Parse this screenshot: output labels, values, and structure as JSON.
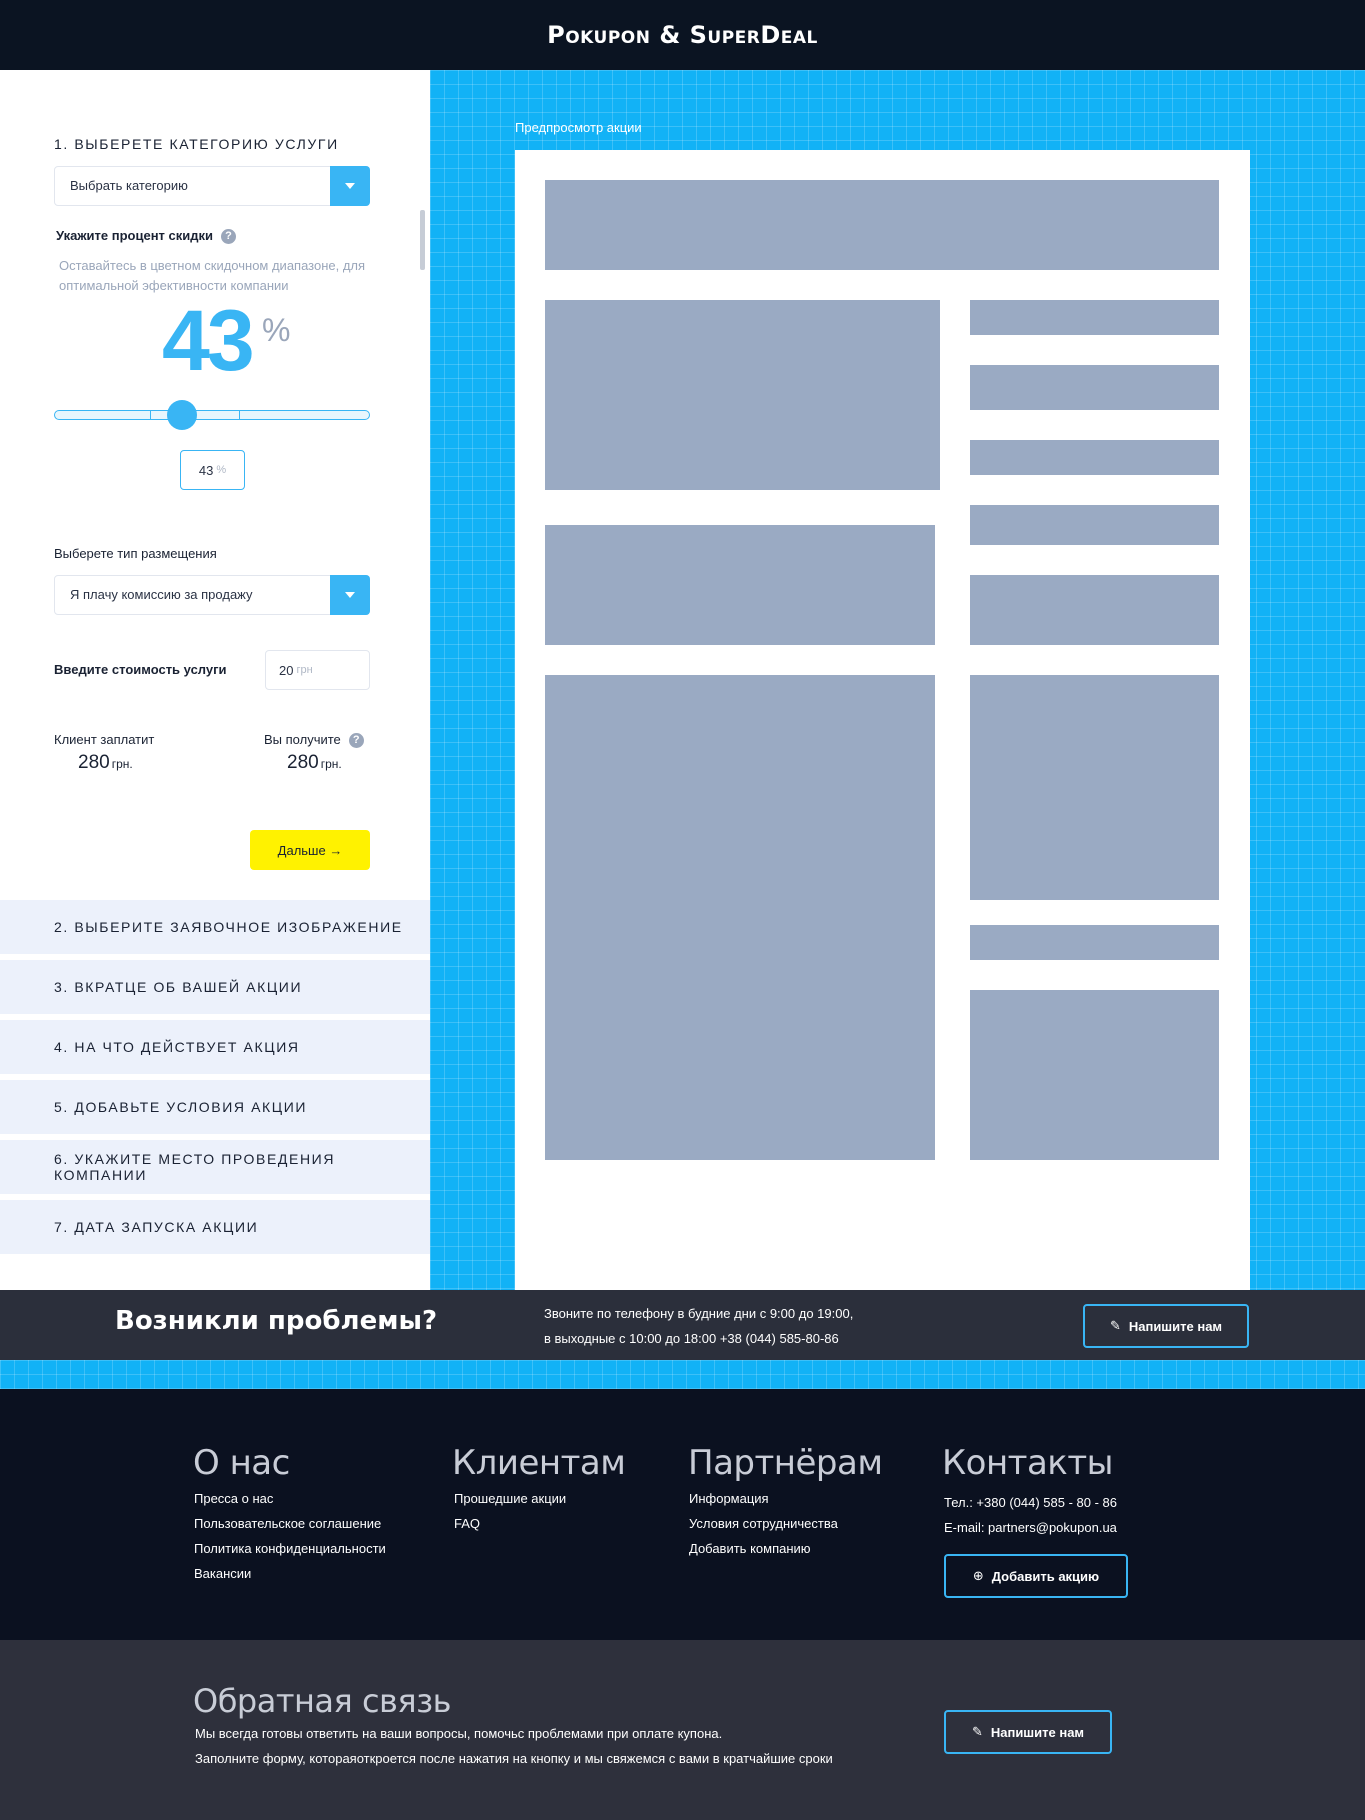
{
  "header": {
    "brand": "Pokupon & SuperDeal"
  },
  "form": {
    "step1_title": "1. Выберете категорию услуги",
    "category": {
      "value": "Выбрать категорию"
    },
    "discount": {
      "label": "Укажите процент скидки",
      "hint": "Оставайтесь в цветном скидочном диапазоне, для оптимальной эфективности компании",
      "value": "43",
      "symbol": "%",
      "input_value": "43",
      "input_unit": "%",
      "slider_fraction": 0.43
    },
    "placement": {
      "label": "Выберете тип размещения",
      "value": "Я плачу комиссию за продажу"
    },
    "price": {
      "label": "Введите стоимость услуги",
      "value": "20",
      "unit": "грн"
    },
    "client_pays": {
      "label": "Клиент заплатит",
      "amount": "280",
      "unit": "грн."
    },
    "you_receive": {
      "label": "Вы получите",
      "amount": "280",
      "unit": "грн."
    },
    "next_label": "Дальше →",
    "help_glyph": "?"
  },
  "steps": [
    "2. Выберите заявочное изображение",
    "3. Вкратце об вашей акции",
    "4. На что действует акция",
    "5. Добавьте условия акции",
    "6. Укажите место проведения компании",
    "7. Дата запуска акции"
  ],
  "preview": {
    "label": "Предпросмотр акции"
  },
  "problems": {
    "title": "Возникли проблемы?",
    "line1": "Звоните по телефону в будние дни с 9:00 до 19:00,",
    "line2": "в выходные с 10:00 до 18:00 +38 (044) 585-80-86",
    "button": "Напишите нам",
    "button_icon": "edit-icon"
  },
  "footer": {
    "about": {
      "title": "О нас",
      "links": [
        "Пресса о нас",
        "Пользовательское соглашение",
        "Политика конфиденциальности",
        "Вакансии"
      ]
    },
    "clients": {
      "title": "Клиентам",
      "links": [
        "Прошедшие акции",
        "FAQ"
      ]
    },
    "partners": {
      "title": "Партнёрам",
      "links": [
        "Информация",
        "Условия сотрудничества",
        "Добавить компанию"
      ]
    },
    "contacts": {
      "title": "Контакты",
      "phone": "Тел.: +380 (044) 585 - 80 - 86",
      "email": "E-mail: partners@pokupon.ua",
      "button": "Добавить акцию",
      "button_icon": "plus-circle-icon"
    }
  },
  "feedback": {
    "title": "Обратная связь",
    "line1": "Мы всегда готовы ответить на ваши вопросы, помочьс проблемами при оплате купона.",
    "line2": "Заполните форму, котораяоткроется после нажатия на кнопку и мы свяжемся с вами в кратчайшие сроки",
    "button": "Напишите нам",
    "button_icon": "edit-icon"
  },
  "colors": {
    "accent": "#39b5f4",
    "cta": "#fff200",
    "placeholder": "#9aaac3",
    "grid": "#12b2f6"
  }
}
